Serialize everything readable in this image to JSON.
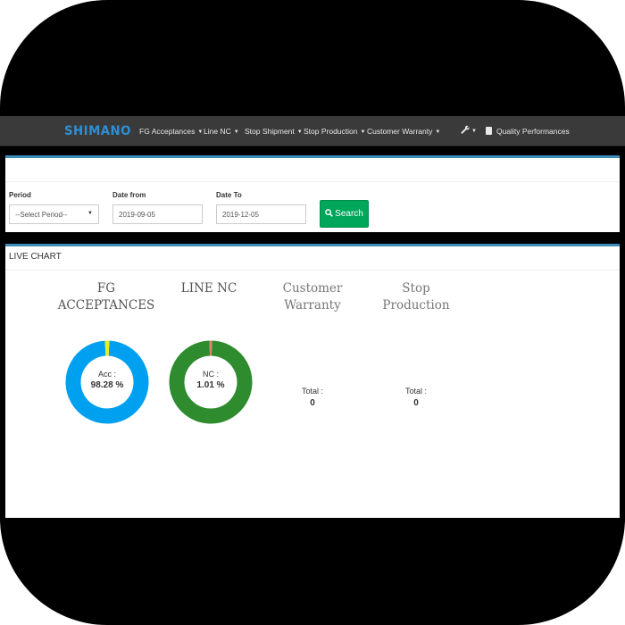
{
  "navbar": {
    "brand": "SHIMANO",
    "items": [
      {
        "label": "FG Acceptances"
      },
      {
        "label": "Line NC"
      },
      {
        "label": "Stop Shipment"
      },
      {
        "label": "Stop Production"
      },
      {
        "label": "Customer Warranty"
      }
    ],
    "tools_icon": "wrench-icon",
    "quality": {
      "label": "Quality Performances",
      "icon": "book-icon"
    }
  },
  "filter": {
    "period_label": "Period",
    "period_value": "--Select Period--",
    "date_from_label": "Date from",
    "date_from_value": "2019-09-05",
    "date_to_label": "Date To",
    "date_to_value": "2019-12-05",
    "search_label": "Search"
  },
  "live_chart": {
    "title": "LIVE CHART",
    "columns": [
      {
        "title_line1": "FG",
        "title_line2": "ACCEPTANCES",
        "kind": "donut",
        "label": "Acc :",
        "value": "98.28 %",
        "percent": 98.28,
        "main_color": "#00a0f0",
        "rest_color": "#e8ef20"
      },
      {
        "title_line1": "LINE NC",
        "title_line2": "",
        "kind": "donut",
        "label": "NC :",
        "value": "1.01 %",
        "percent": 1.01,
        "main_color": "#2e8b2e",
        "rest_color": "#e0806a"
      },
      {
        "title_line1": "Customer",
        "title_line2": "Warranty",
        "kind": "total",
        "label": "Total :",
        "value": "0"
      },
      {
        "title_line1": "Stop",
        "title_line2": "Production",
        "kind": "total",
        "label": "Total :",
        "value": "0"
      }
    ]
  },
  "colors": {
    "navbar_bg": "#3a3a3a",
    "brand": "#2d8fd5",
    "panel_accent": "#3c8dbc",
    "search_button": "#00a65a"
  }
}
